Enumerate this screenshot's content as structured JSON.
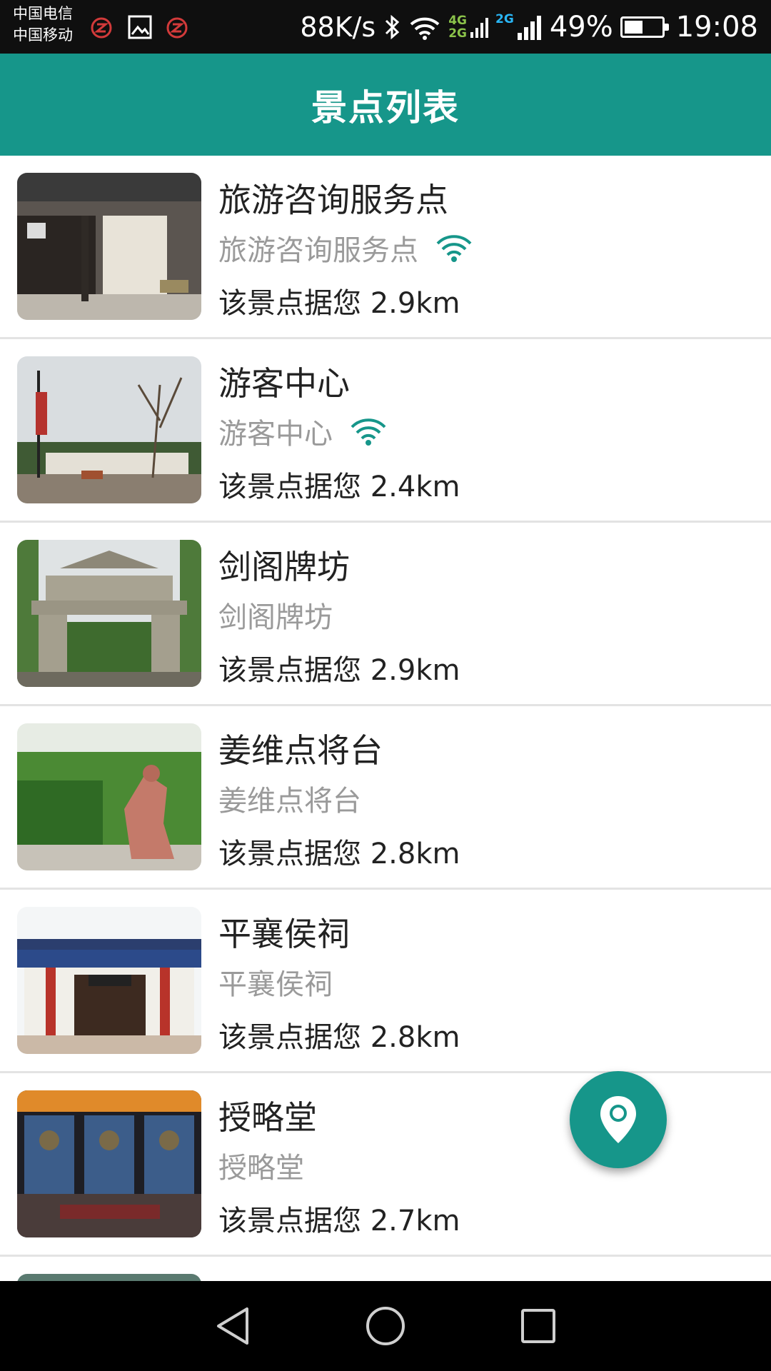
{
  "status_bar": {
    "carrier_1": "中国电信",
    "carrier_2": "中国移动",
    "net_speed": "88K/s",
    "net_4g": "4G",
    "net_2g_a": "2G",
    "net_2g_b": "2G",
    "battery": "49%",
    "battery_level": 0.49,
    "time": "19:08"
  },
  "app_bar": {
    "title": "景点列表"
  },
  "spots": [
    {
      "name": "旅游咨询服务点",
      "subtitle": "旅游咨询服务点",
      "distance": "该景点据您 2.9km",
      "wifi": true
    },
    {
      "name": "游客中心",
      "subtitle": "游客中心",
      "distance": "该景点据您 2.4km",
      "wifi": true
    },
    {
      "name": "剑阁牌坊",
      "subtitle": "剑阁牌坊",
      "distance": "该景点据您 2.9km",
      "wifi": false
    },
    {
      "name": "姜维点将台",
      "subtitle": "姜维点将台",
      "distance": "该景点据您 2.8km",
      "wifi": false
    },
    {
      "name": "平襄侯祠",
      "subtitle": "平襄侯祠",
      "distance": "该景点据您 2.8km",
      "wifi": false
    },
    {
      "name": "授略堂",
      "subtitle": "授略堂",
      "distance": "该景点据您 2.7km",
      "wifi": false
    }
  ],
  "colors": {
    "accent": "#16968a",
    "wifi": "#16968a",
    "subtitle": "#9a9a9a"
  },
  "icons": {
    "fab": "location-pin-icon",
    "nav_back": "back-triangle-icon",
    "nav_home": "home-circle-icon",
    "nav_recent": "recent-square-icon"
  }
}
